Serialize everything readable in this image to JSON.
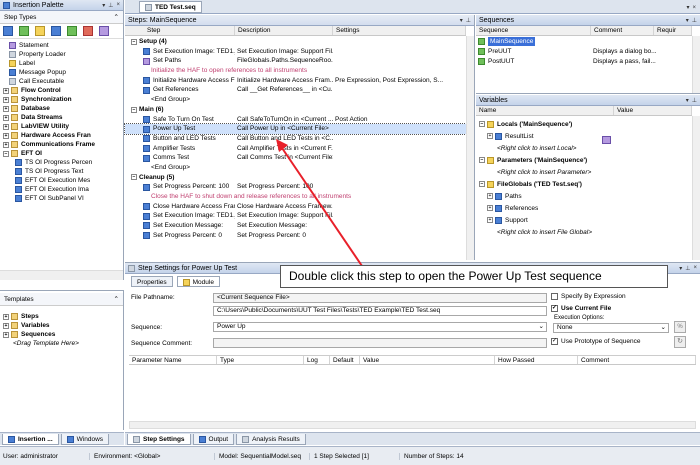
{
  "insertion_palette": {
    "title": "Insertion Palette",
    "dropdown": "Step Types",
    "items": [
      {
        "label": "Statement",
        "indent": 1,
        "icon": "fx-icon",
        "bold": false
      },
      {
        "label": "Property Loader",
        "indent": 1,
        "icon": "property-loader-icon",
        "bold": false
      },
      {
        "label": "Label",
        "indent": 1,
        "icon": "label-icon",
        "bold": false
      },
      {
        "label": "Message Popup",
        "indent": 1,
        "icon": "message-popup-icon",
        "bold": false
      },
      {
        "label": "Call Executable",
        "indent": 1,
        "icon": "call-executable-icon",
        "bold": false
      },
      {
        "label": "Flow Control",
        "indent": 0,
        "icon": "folder-icon",
        "bold": true
      },
      {
        "label": "Synchronization",
        "indent": 0,
        "icon": "folder-icon",
        "bold": true
      },
      {
        "label": "Database",
        "indent": 0,
        "icon": "folder-icon",
        "bold": true
      },
      {
        "label": "Data Streams",
        "indent": 0,
        "icon": "folder-icon",
        "bold": true
      },
      {
        "label": "LabVIEW Utility",
        "indent": 0,
        "icon": "folder-icon",
        "bold": true
      },
      {
        "label": "Hardware Access Fran",
        "indent": 0,
        "icon": "folder-icon",
        "bold": true
      },
      {
        "label": "Communications Frame",
        "indent": 0,
        "icon": "folder-icon",
        "bold": true
      },
      {
        "label": "EFT OI",
        "indent": 0,
        "icon": "folder-icon",
        "bold": true
      },
      {
        "label": "TS OI Progress Percen",
        "indent": 2,
        "icon": "vi-icon",
        "bold": false
      },
      {
        "label": "TS OI Progress Text",
        "indent": 2,
        "icon": "vi-icon",
        "bold": false
      },
      {
        "label": "EFT OI Execution Mes",
        "indent": 2,
        "icon": "vi-icon",
        "bold": false
      },
      {
        "label": "EFT OI Execution Ima",
        "indent": 2,
        "icon": "vi-icon",
        "bold": false
      },
      {
        "label": "EFT OI SubPanel VI",
        "indent": 2,
        "icon": "vi-icon",
        "bold": false
      }
    ]
  },
  "templates": {
    "dropdown": "Templates",
    "items": [
      "Steps",
      "Variables",
      "Sequences"
    ],
    "hint": "<Drag Template Here>"
  },
  "left_tabs": [
    "Insertion ...",
    "Windows"
  ],
  "doc_tab": "TED Test.seq",
  "steps_pane": {
    "title": "Steps: MainSequence",
    "columns": [
      "Step",
      "Description",
      "Settings"
    ],
    "rows": [
      {
        "type": "group",
        "step": "Setup (4)"
      },
      {
        "type": "step",
        "step": "Set Execution Image: TED1.jpg",
        "desc": "Set Execution Image: Support Fil...",
        "settings": ""
      },
      {
        "type": "step",
        "step": "Set Paths",
        "desc": "FileGlobals.Paths.SequenceRoo...",
        "settings": "",
        "icon": "fx"
      },
      {
        "type": "comment",
        "step": "Initialize the HAF to open references to all instruments"
      },
      {
        "type": "step",
        "step": "Initialize Hardware Access Fr...",
        "desc": "Initialize Hardware Access Fram...",
        "settings": "Pre Expression, Post Expression, S..."
      },
      {
        "type": "step",
        "step": "Get References",
        "desc": "Call __Get References__ in <Cu...",
        "settings": ""
      },
      {
        "type": "end",
        "step": "<End Group>"
      },
      {
        "type": "group",
        "step": "Main (6)"
      },
      {
        "type": "step",
        "step": "Safe To Turn On Test",
        "desc": "Call SafeToTurnOn in <Current ...",
        "settings": "Post Action"
      },
      {
        "type": "step",
        "step": "Power Up Test",
        "desc": "Call Power Up in <Current File>",
        "settings": "",
        "selected": true
      },
      {
        "type": "step",
        "step": "Button and LED Tests",
        "desc": "Call Button and LED Tests in <C...",
        "settings": ""
      },
      {
        "type": "step",
        "step": "Amplifier Tests",
        "desc": "Call Amplifier Tests in <Current F...",
        "settings": ""
      },
      {
        "type": "step",
        "step": "Comms Test",
        "desc": "Call Comms Test in <Current File>",
        "settings": ""
      },
      {
        "type": "end",
        "step": "<End Group>"
      },
      {
        "type": "group",
        "step": "Cleanup (5)"
      },
      {
        "type": "step",
        "step": "Set Progress Percent: 100",
        "desc": "Set Progress Percent: 100",
        "settings": ""
      },
      {
        "type": "comment",
        "step": "Close the HAF to shut down and release references to all instruments"
      },
      {
        "type": "step",
        "step": "Close Hardware Access Fram...",
        "desc": "Close Hardware Access Framew...",
        "settings": ""
      },
      {
        "type": "step",
        "step": "Set Execution Image: TED1.jpg",
        "desc": "Set Execution Image: Support Fil...",
        "settings": ""
      },
      {
        "type": "step",
        "step": "Set Execution Message:",
        "desc": "Set Execution Message:",
        "settings": ""
      },
      {
        "type": "step",
        "step": "Set Progress Percent: 0",
        "desc": "Set Progress Percent: 0",
        "settings": ""
      }
    ]
  },
  "sequences_pane": {
    "title": "Sequences",
    "columns": [
      "Sequence",
      "Comment",
      "Requir"
    ],
    "rows": [
      {
        "name": "MainSequence",
        "comment": "",
        "selected": true
      },
      {
        "name": "PreUUT",
        "comment": "Displays a dialog bo..."
      },
      {
        "name": "PostUUT",
        "comment": "Displays a pass, fail..."
      }
    ]
  },
  "variables_pane": {
    "title": "Variables",
    "columns": [
      "Name",
      "Value"
    ],
    "rows": [
      {
        "label": "Locals ('MainSequence')",
        "indent": 0,
        "bold": true,
        "italic": false
      },
      {
        "label": "ResultList",
        "indent": 1,
        "bold": false,
        "italic": false
      },
      {
        "label": "<Right click to insert Local>",
        "indent": 1,
        "bold": false,
        "italic": true
      },
      {
        "label": "Parameters ('MainSequence')",
        "indent": 0,
        "bold": true,
        "italic": false
      },
      {
        "label": "<Right click to insert Parameter>",
        "indent": 1,
        "bold": false,
        "italic": true
      },
      {
        "label": "FileGlobals ('TED Test.seq')",
        "indent": 0,
        "bold": true,
        "italic": false
      },
      {
        "label": "Paths",
        "indent": 1,
        "bold": false,
        "italic": false
      },
      {
        "label": "References",
        "indent": 1,
        "bold": false,
        "italic": false
      },
      {
        "label": "Support",
        "indent": 1,
        "bold": false,
        "italic": false
      },
      {
        "label": "<Right click to insert File Global>",
        "indent": 1,
        "bold": false,
        "italic": true
      }
    ]
  },
  "step_settings": {
    "title": "Step Settings for Power Up Test",
    "tabs": [
      "Properties",
      "Module"
    ],
    "file_pathname_label": "File Pathname:",
    "file_pathname_value": "<Current Sequence File>",
    "file_path_full": "C:\\Users\\Public\\Documents\\UUT Test Files\\Tests\\TED Example\\TED Test.seq",
    "sequence_label": "Sequence:",
    "sequence_value": "Power Up",
    "comment_label": "Sequence Comment:",
    "specify_by_expression": "Specify By Expression",
    "use_current_file": "Use Current File",
    "execution_options_label": "Execution Options:",
    "execution_options_value": "None",
    "use_prototype": "Use Prototype of Sequence",
    "param_columns": [
      "Parameter Name",
      "Type",
      "Log",
      "Default",
      "Value",
      "How Passed",
      "Comment"
    ]
  },
  "bottom_tabs": [
    "Step Settings",
    "Output",
    "Analysis Results"
  ],
  "status_bar": [
    "User: administrator",
    "Environment: <Global>",
    "Model: SequentialModel.seq",
    "1 Step Selected [1]",
    "Number of Steps: 14"
  ],
  "callout": "Double click this step to open the Power Up Test sequence",
  "colors": {
    "accent": "#3a6fd8",
    "callout_arrow": "#e8202a",
    "selection": "#cfe1fb",
    "comment": "#c04070"
  }
}
